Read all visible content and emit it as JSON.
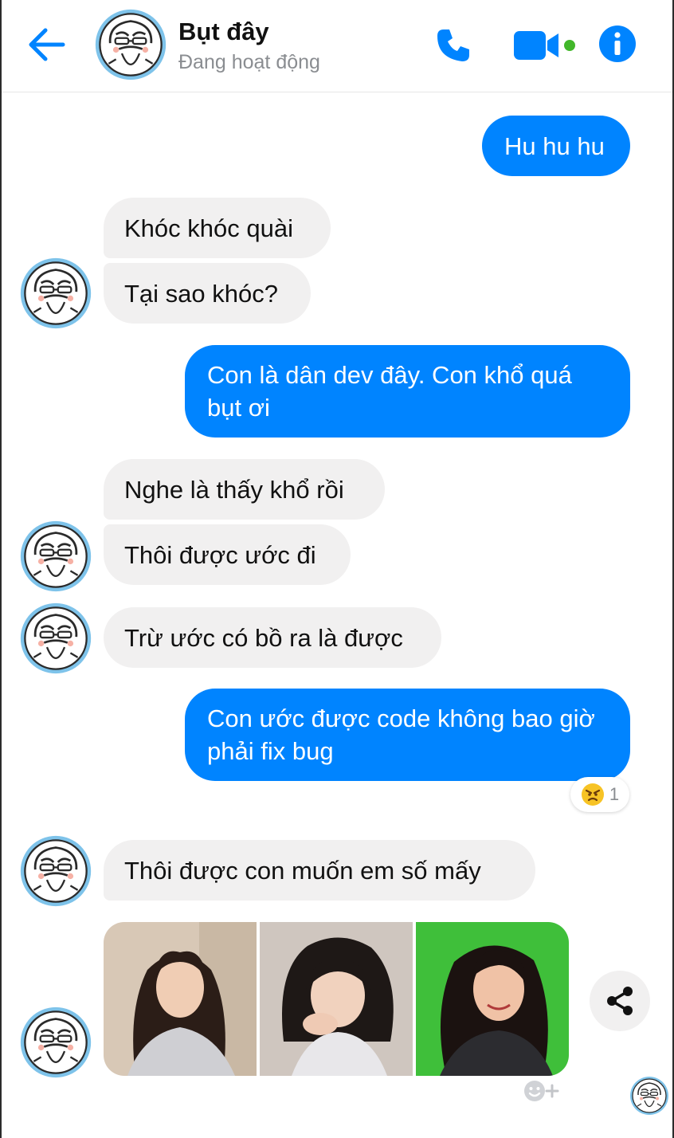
{
  "header": {
    "contact_name": "Bụt đây",
    "status": "Đang hoạt động",
    "icons": [
      "back-arrow-icon",
      "phone-icon",
      "video-camera-icon",
      "active-dot-icon",
      "info-icon"
    ]
  },
  "colors": {
    "accent": "#0084ff",
    "incoming_bubble": "#f1f0f0",
    "active_green": "#42b72a",
    "status_gray": "#8a8d91"
  },
  "messages": [
    {
      "from": "me",
      "text": "Hu hu hu"
    },
    {
      "from": "contact",
      "text": "Khóc khóc quài"
    },
    {
      "from": "contact",
      "text": "Tại sao khóc?"
    },
    {
      "from": "me",
      "text": "Con là dân dev đây. Con khổ quá bụt ơi"
    },
    {
      "from": "contact",
      "text": "Nghe là thấy khổ rồi"
    },
    {
      "from": "contact",
      "text": "Thôi được ước đi"
    },
    {
      "from": "contact",
      "text": "Trừ ước có bồ ra là được"
    },
    {
      "from": "me",
      "text": "Con ước được code không bao giờ phải fix bug"
    },
    {
      "from": "contact",
      "text": "Thôi được con muốn em số mấy"
    }
  ],
  "reaction": {
    "icon": "angry-face-icon",
    "count": "1"
  },
  "photos": {
    "count": 3,
    "items": [
      "photo-1",
      "photo-2",
      "photo-3"
    ]
  },
  "actions": {
    "share_icon": "share-icon",
    "add_reaction_icon": "add-reaction-icon"
  }
}
